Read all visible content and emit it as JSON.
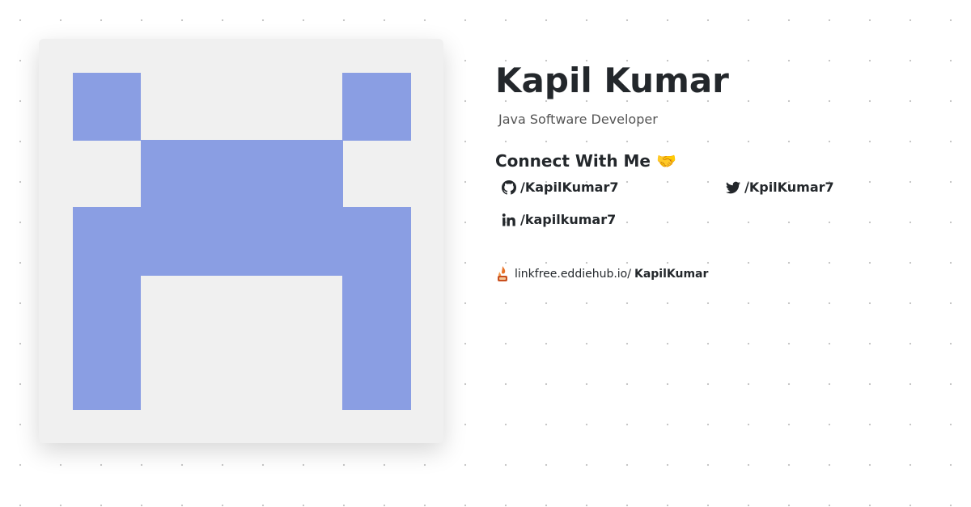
{
  "profile": {
    "name": "Kapil Kumar",
    "title": "Java Software Developer"
  },
  "avatar": {
    "color": "#8a9ee3",
    "background": "#f0f0f0",
    "icon": "identicon"
  },
  "connect": {
    "heading": "Connect With Me",
    "emoji": "🤝",
    "links": [
      {
        "icon": "github-icon",
        "label": "/KapilKumar7"
      },
      {
        "icon": "twitter-icon",
        "label": "/KpilKumar7"
      },
      {
        "icon": "linkedin-icon",
        "label": "/kapilkumar7"
      }
    ]
  },
  "linkfree": {
    "icon": "linkfree-logo-icon",
    "prefix": "linkfree.eddiehub.io/",
    "handle": "KapilKumar"
  }
}
